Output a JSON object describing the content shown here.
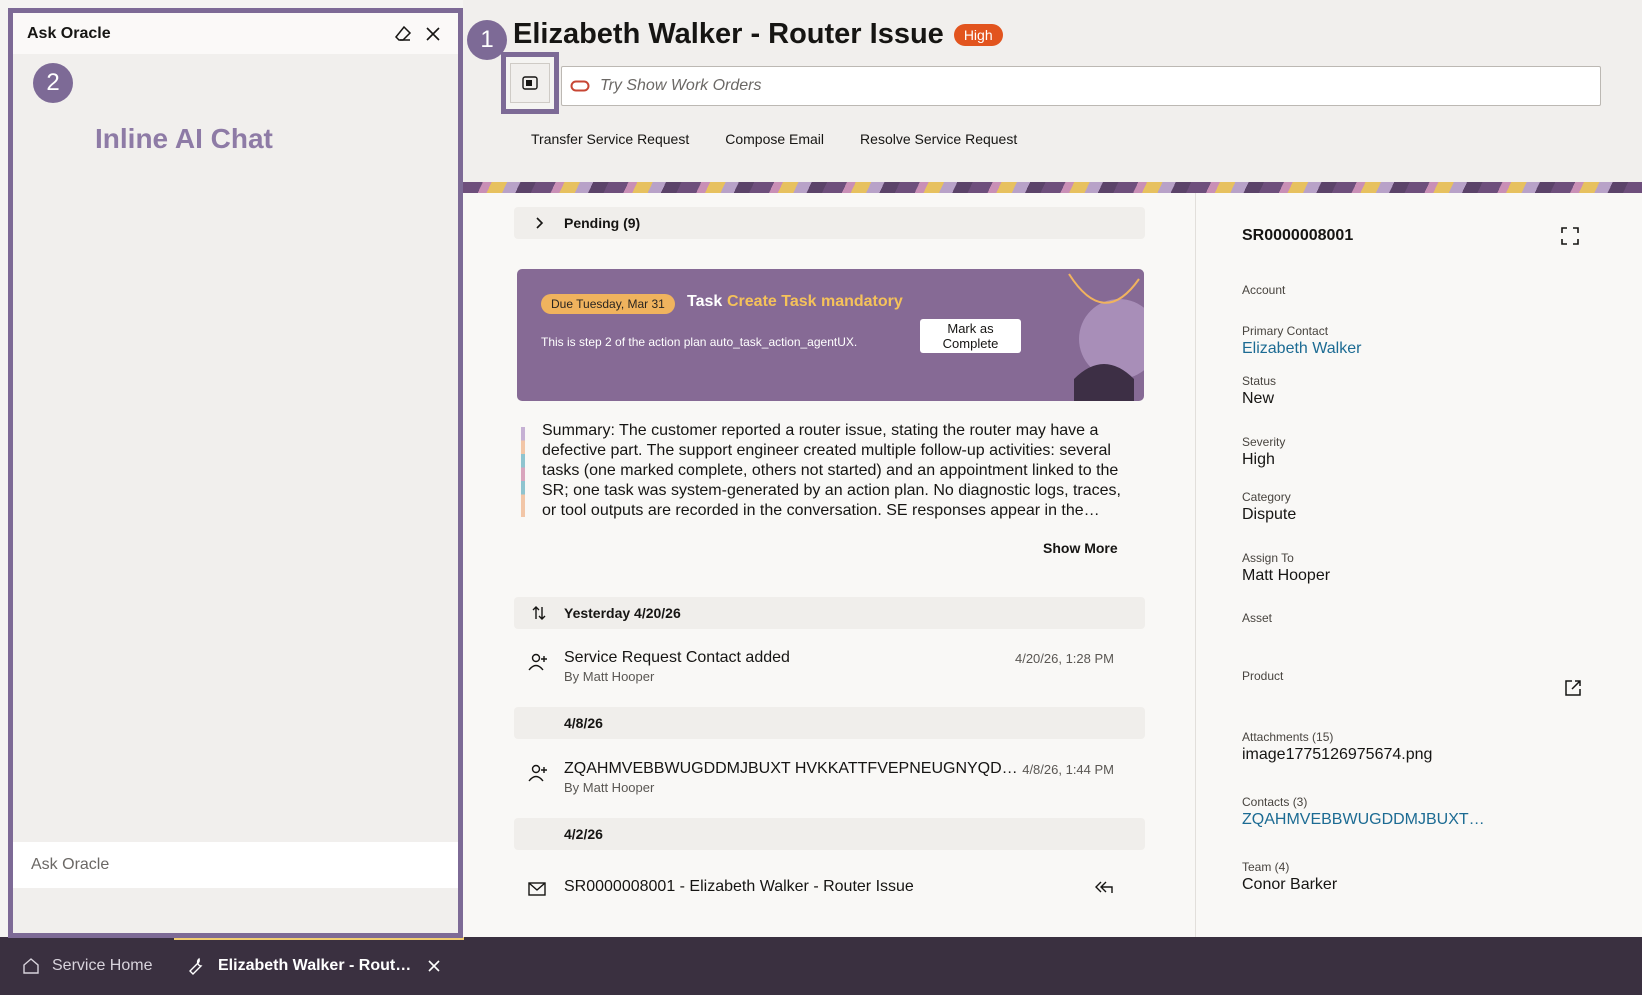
{
  "chat": {
    "title": "Ask Oracle",
    "annotation": "Inline AI Chat",
    "callout_number": "2",
    "input_placeholder": "Ask Oracle"
  },
  "header": {
    "callout_number": "1",
    "title": "Elizabeth Walker - Router Issue",
    "severity_badge": "High",
    "search_placeholder": "Try Show Work Orders",
    "actions": [
      "Transfer Service Request",
      "Compose Email",
      "Resolve Service Request"
    ]
  },
  "feed": {
    "pending_label": "Pending (9)",
    "task": {
      "due": "Due Tuesday, Mar 31",
      "label": "Task",
      "name": "Create Task mandatory",
      "description": "This is step 2 of the action plan auto_task_action_agentUX.",
      "mark_button": "Mark as Complete"
    },
    "summary": "Summary: The customer reported a router issue, stating the router may have a defective part. The support engineer created multiple follow-up activities: several tasks (one marked complete, others not started) and an appointment linked to the SR; one task was system-generated by an action plan. No diagnostic logs, traces, or tool outputs are recorded in the conversation. SE responses appear in the…",
    "show_more": "Show More",
    "groups": [
      {
        "date": "Yesterday 4/20/26"
      },
      {
        "date": "4/8/26"
      },
      {
        "date": "4/2/26"
      }
    ],
    "activities": [
      {
        "title": "Service Request Contact added",
        "by": "By Matt Hooper",
        "time": "4/20/26, 1:28 PM"
      },
      {
        "title": "ZQAHMVEBBWUGDDMJBUXT HVKKATTFVEPNEUGNYQD…",
        "by": "By Matt Hooper",
        "time": "4/8/26, 1:44 PM"
      },
      {
        "title": "SR0000008001 - Elizabeth Walker - Router Issue"
      }
    ]
  },
  "details": {
    "sr_number": "SR0000008001",
    "fields": {
      "account": {
        "label": "Account",
        "value": ""
      },
      "primary_contact": {
        "label": "Primary Contact",
        "value": "Elizabeth Walker"
      },
      "status": {
        "label": "Status",
        "value": "New"
      },
      "severity": {
        "label": "Severity",
        "value": "High"
      },
      "category": {
        "label": "Category",
        "value": "Dispute"
      },
      "assign_to": {
        "label": "Assign To",
        "value": "Matt Hooper"
      },
      "asset": {
        "label": "Asset",
        "value": ""
      },
      "product": {
        "label": "Product",
        "value": ""
      },
      "attachments": {
        "label": "Attachments (15)",
        "value": "image1775126975674.png"
      },
      "contacts": {
        "label": "Contacts (3)",
        "value": "ZQAHMVEBBWUGDDMJBUXT…"
      },
      "team": {
        "label": "Team (4)",
        "value": "Conor Barker"
      }
    }
  },
  "tabs": {
    "home": "Service Home",
    "active": "Elizabeth Walker - Rout…"
  },
  "colors": {
    "accent_purple": "#7d6a96",
    "severity_orange": "#e2541e",
    "link_blue": "#1c6b93",
    "task_highlight": "#f5c25a"
  }
}
